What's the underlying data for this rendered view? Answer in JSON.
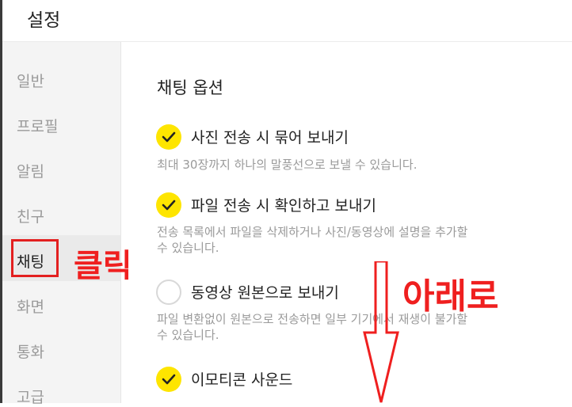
{
  "window": {
    "title": "설정"
  },
  "sidebar": {
    "items": [
      {
        "label": "일반",
        "active": false
      },
      {
        "label": "프로필",
        "active": false
      },
      {
        "label": "알림",
        "active": false
      },
      {
        "label": "친구",
        "active": false
      },
      {
        "label": "채팅",
        "active": true
      },
      {
        "label": "화면",
        "active": false
      },
      {
        "label": "통화",
        "active": false
      },
      {
        "label": "고급",
        "active": false
      }
    ]
  },
  "annotations": {
    "click": "클릭",
    "down": "아래로",
    "color": "#ef1f1f"
  },
  "main": {
    "section_title": "채팅 옵션",
    "options": [
      {
        "label": "사진 전송 시 묶어 보내기",
        "checked": true,
        "desc_lines": [
          "최대 30장까지 하나의 말풍선으로 보낼 수 있습니다."
        ]
      },
      {
        "label": "파일 전송 시 확인하고 보내기",
        "checked": true,
        "desc_lines": [
          "전송 목록에서 파일을 삭제하거나 사진/동영상에 설명을 추가할",
          "수 있습니다."
        ]
      },
      {
        "label": "동영상 원본으로 보내기",
        "checked": false,
        "desc_lines": [
          "파일 변환없이 원본으로 전송하면 일부 기기에서 재생이 불가할",
          "수 있습니다."
        ]
      },
      {
        "label": "이모티콘 사운드",
        "checked": true,
        "desc_lines": []
      }
    ]
  },
  "colors": {
    "check_on": "#fee500",
    "accent_red": "#ef1f1f"
  }
}
